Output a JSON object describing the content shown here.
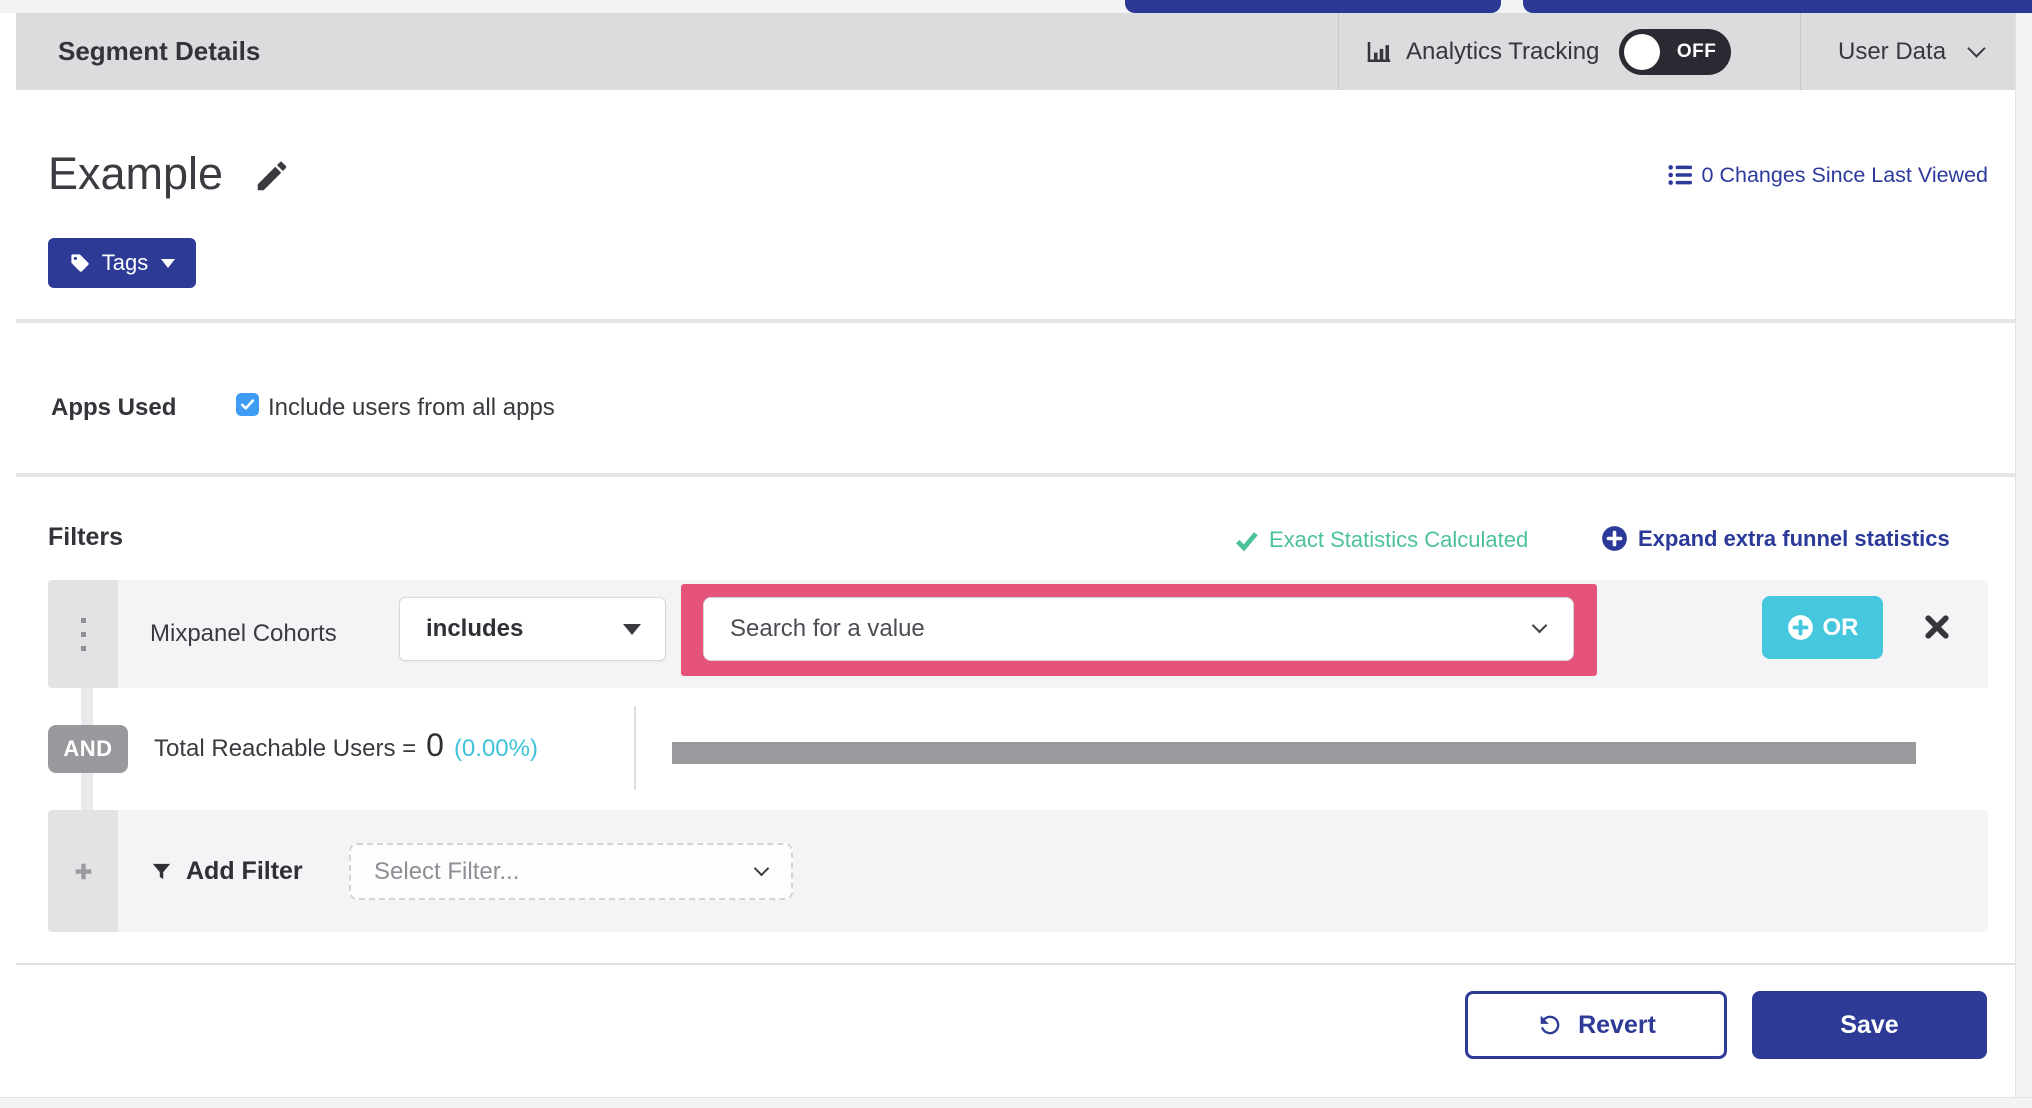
{
  "header": {
    "title": "Segment Details",
    "analytics": {
      "label": "Analytics Tracking",
      "toggle": "OFF"
    },
    "user_data": {
      "label": "User Data"
    }
  },
  "segment": {
    "name": "Example",
    "changes_link": "0 Changes Since Last Viewed",
    "tags_button": "Tags"
  },
  "apps_used": {
    "label": "Apps Used",
    "include_all": "Include users from all apps",
    "checked": true
  },
  "filters": {
    "heading": "Filters",
    "exact_statistics": "Exact Statistics Calculated",
    "expand_statistics": "Expand extra funnel statistics",
    "filter_row": {
      "name": "Mixpanel Cohorts",
      "operator": "includes",
      "value_placeholder": "Search for a value",
      "or_button": "OR"
    },
    "conjunction": "AND",
    "reachable_users": {
      "label": "Total Reachable Users =",
      "value": "0",
      "percent": "(0.00%)"
    },
    "add_filter": {
      "label": "Add Filter",
      "placeholder": "Select Filter..."
    }
  },
  "footer": {
    "revert": "Revert",
    "save": "Save"
  },
  "colors": {
    "brand_blue": "#2e3b96",
    "link_blue": "#2c3a9b",
    "teal": "#45c8dd",
    "success_green": "#4cc19c",
    "highlight_pink": "#e5537b",
    "toggle_off_bg": "#2a2a32",
    "checkbox_blue": "#3f9cf4",
    "progress_gray": "#9a9a9e",
    "header_gray": "#dcdcdf"
  }
}
